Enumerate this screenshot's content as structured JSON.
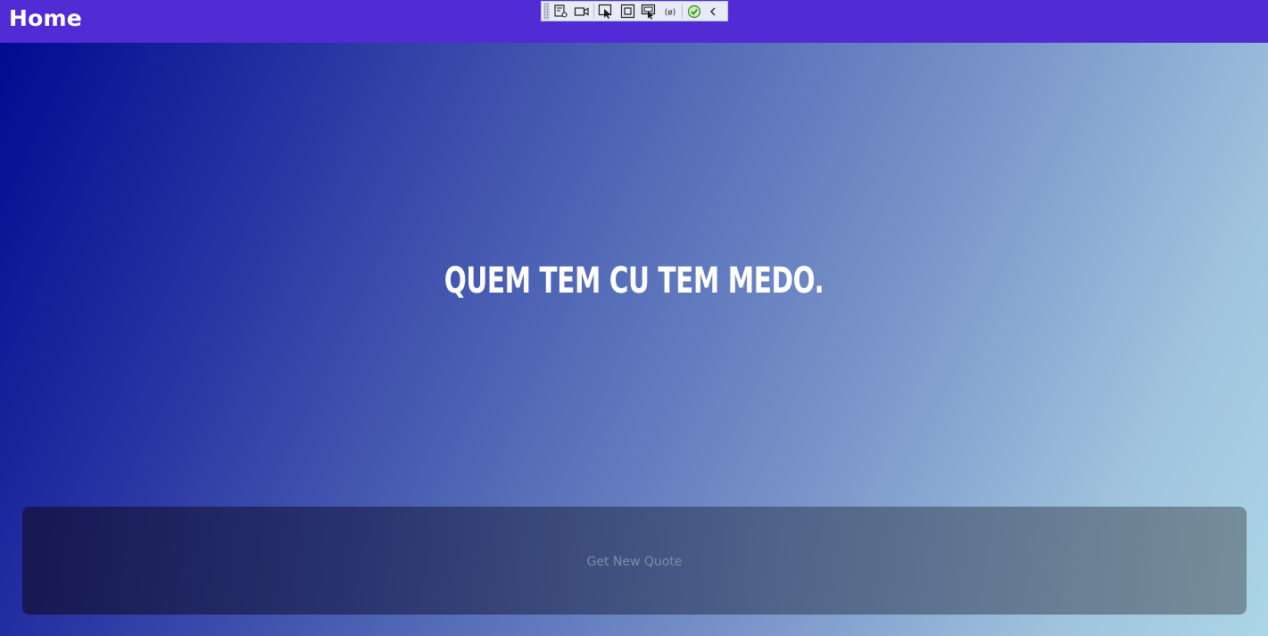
{
  "app": {
    "title": "Home"
  },
  "debug_toolbar": {
    "buttons": [
      {
        "icon": "live-visual-tree-icon"
      },
      {
        "icon": "camera-icon"
      },
      {
        "icon": "select-element-icon"
      },
      {
        "icon": "layout-adorners-icon"
      },
      {
        "icon": "track-focus-icon"
      },
      {
        "icon": "binding-failures-icon"
      },
      {
        "icon": "accessibility-check-icon"
      },
      {
        "icon": "collapse-chevron-icon"
      }
    ]
  },
  "main": {
    "quote": "QUEM TEM CU TEM MEDO.",
    "button_label": "Get New Quote"
  },
  "colors": {
    "topbar": "#512BD4",
    "gradient_start": "#000b91",
    "gradient_end": "#acd5e6",
    "quote_text": "#ffffff",
    "button_text": "#7f8ca6"
  }
}
